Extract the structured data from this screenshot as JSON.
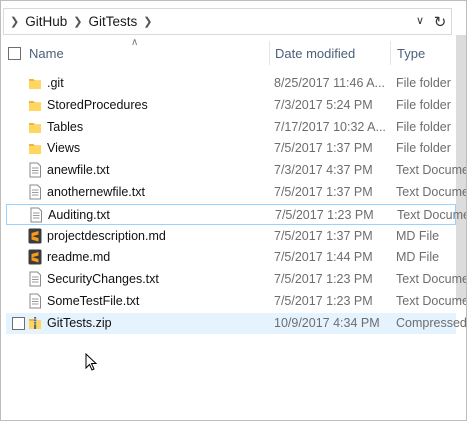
{
  "breadcrumb": [
    "GitHub",
    "GitTests"
  ],
  "columns": {
    "name": "Name",
    "date": "Date modified",
    "type": "Type"
  },
  "files": [
    {
      "name": ".git",
      "date": "8/25/2017 11:46 A...",
      "type": "File folder",
      "icon": "folder-icon"
    },
    {
      "name": "StoredProcedures",
      "date": "7/3/2017 5:24 PM",
      "type": "File folder",
      "icon": "folder-icon"
    },
    {
      "name": "Tables",
      "date": "7/17/2017 10:32 A...",
      "type": "File folder",
      "icon": "folder-icon"
    },
    {
      "name": "Views",
      "date": "7/5/2017 1:37 PM",
      "type": "File folder",
      "icon": "folder-icon"
    },
    {
      "name": "anewfile.txt",
      "date": "7/3/2017 4:37 PM",
      "type": "Text Docume",
      "icon": "text-file-icon"
    },
    {
      "name": "anothernewfile.txt",
      "date": "7/5/2017 1:37 PM",
      "type": "Text Docume",
      "icon": "text-file-icon"
    },
    {
      "name": "Auditing.txt",
      "date": "7/5/2017 1:23 PM",
      "type": "Text Docume",
      "icon": "text-file-icon",
      "state": "selected"
    },
    {
      "name": "projectdescription.md",
      "date": "7/5/2017 1:37 PM",
      "type": "MD File",
      "icon": "sublime-file-icon"
    },
    {
      "name": "readme.md",
      "date": "7/5/2017 1:44 PM",
      "type": "MD File",
      "icon": "sublime-file-icon"
    },
    {
      "name": "SecurityChanges.txt",
      "date": "7/5/2017 1:23 PM",
      "type": "Text Docume",
      "icon": "text-file-icon"
    },
    {
      "name": "SomeTestFile.txt",
      "date": "7/5/2017 1:23 PM",
      "type": "Text Docume",
      "icon": "text-file-icon"
    },
    {
      "name": "GitTests.zip",
      "date": "10/9/2017 4:34 PM",
      "type": "Compressed",
      "icon": "zip-file-icon",
      "state": "hover"
    }
  ]
}
